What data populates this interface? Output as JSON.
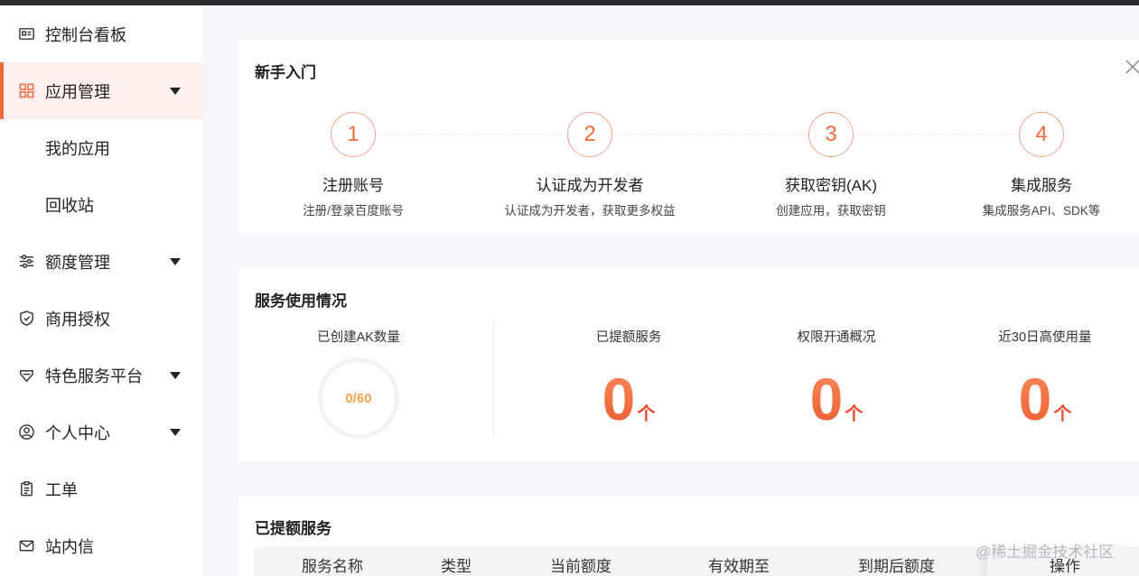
{
  "sidebar": {
    "items": [
      {
        "label": "控制台看板",
        "icon": "id-card-icon"
      },
      {
        "label": "应用管理",
        "icon": "grid-icon"
      },
      {
        "label": "我的应用"
      },
      {
        "label": "回收站"
      },
      {
        "label": "额度管理",
        "icon": "sliders-icon"
      },
      {
        "label": "商用授权",
        "icon": "shield-icon"
      },
      {
        "label": "特色服务平台",
        "icon": "gem-icon"
      },
      {
        "label": "个人中心",
        "icon": "user-icon"
      },
      {
        "label": "工单",
        "icon": "clipboard-icon"
      },
      {
        "label": "站内信",
        "icon": "mail-icon"
      }
    ]
  },
  "guide": {
    "title": "新手入门",
    "steps": [
      {
        "num": "1",
        "title": "注册账号",
        "desc": "注册/登录百度账号"
      },
      {
        "num": "2",
        "title": "认证成为开发者",
        "desc": "认证成为开发者，获取更多权益"
      },
      {
        "num": "3",
        "title": "获取密钥(AK)",
        "desc": "创建应用，获取密钥"
      },
      {
        "num": "4",
        "title": "集成服务",
        "desc": "集成服务API、SDK等"
      }
    ]
  },
  "usage": {
    "title": "服务使用情况",
    "ak": {
      "label": "已创建AK数量",
      "value": "0/60"
    },
    "stats": [
      {
        "label": "已提额服务",
        "value": "0",
        "unit": "个"
      },
      {
        "label": "权限开通概况",
        "value": "0",
        "unit": "个"
      },
      {
        "label": "近30日高使用量",
        "value": "0",
        "unit": "个"
      }
    ]
  },
  "quota": {
    "title": "已提额服务",
    "columns": [
      "服务名称",
      "类型",
      "当前额度",
      "有效期至",
      "到期后额度",
      "操作"
    ]
  },
  "watermark": "@稀土掘金技术社区",
  "colors": {
    "accent": "#f0693e",
    "active_bg": "#fff1ee",
    "page_bg": "#f5f6f9"
  }
}
